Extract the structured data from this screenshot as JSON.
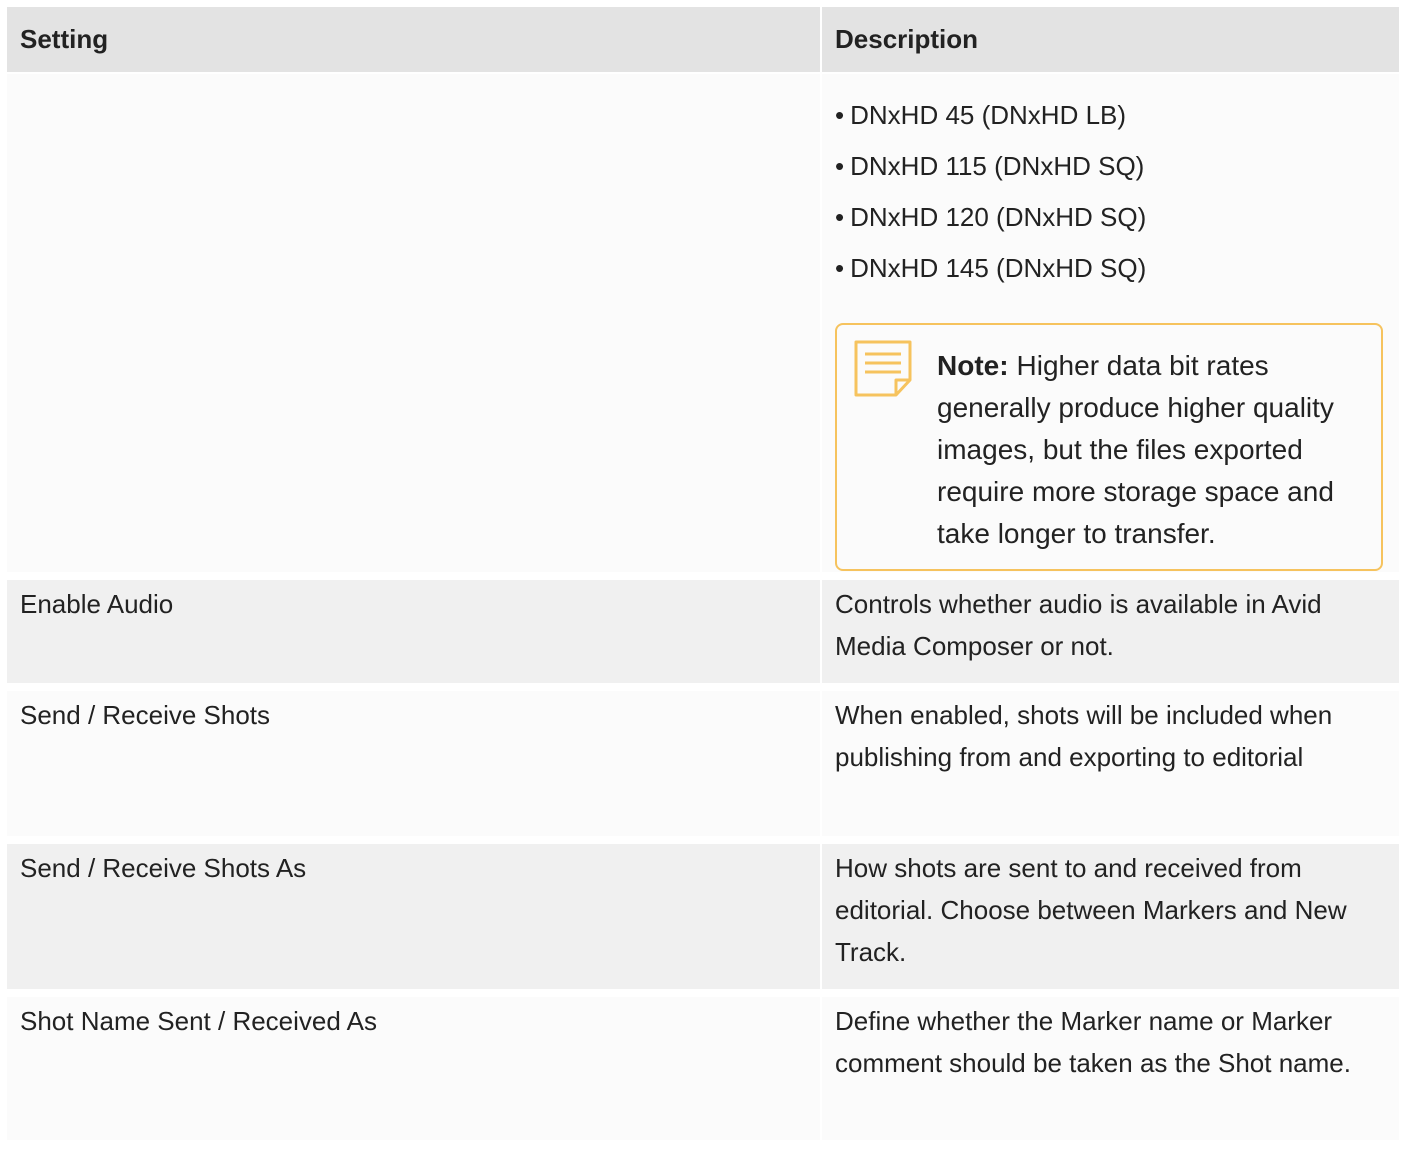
{
  "table": {
    "headers": {
      "setting": "Setting",
      "description": "Description"
    },
    "codec_row": {
      "setting": "",
      "bullets": [
        "DNxHD 45 (DNxHD LB)",
        "DNxHD 115 (DNxHD SQ)",
        "DNxHD 120 (DNxHD SQ)",
        "DNxHD 145 (DNxHD SQ)"
      ],
      "note": {
        "icon": "note-icon",
        "label": "Note:",
        "text": "Higher data bit rates generally produce higher quality images, but the files exported require more storage space and take longer to transfer."
      }
    },
    "rows": [
      {
        "setting": "Enable Audio",
        "description": "Controls whether audio is available in Avid Media Composer or not."
      },
      {
        "setting": "Send / Receive Shots",
        "description": "When enabled, shots will be included when publishing from and exporting to editorial"
      },
      {
        "setting": "Send / Receive Shots As",
        "description": "How shots are sent to and received from editorial. Choose between Markers and New Track."
      },
      {
        "setting": "Shot Name Sent / Received As",
        "description": "Define whether the Marker name or Marker comment should be taken as the Shot name."
      }
    ]
  },
  "colors": {
    "header_bg": "#e3e3e3",
    "row_alt_bg": "#f0f0f0",
    "note_border": "#f6c35e"
  }
}
